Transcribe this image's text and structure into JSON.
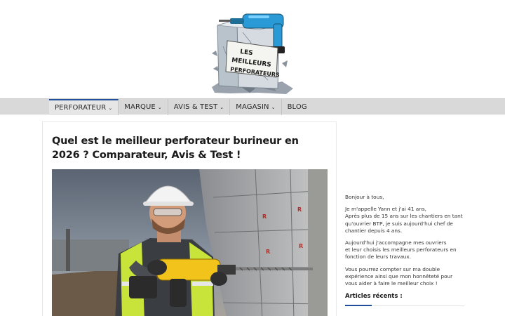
{
  "logo": {
    "line1": "LES",
    "line2": "MEILLEURS",
    "line3": "PERFORATEURS"
  },
  "nav": {
    "items": [
      {
        "label": "PERFORATEUR",
        "dropdown": true,
        "active": true
      },
      {
        "label": "MARQUE",
        "dropdown": true,
        "active": false
      },
      {
        "label": "AVIS & TEST",
        "dropdown": true,
        "active": false
      },
      {
        "label": "MAGASIN",
        "dropdown": true,
        "active": false
      },
      {
        "label": "BLOG",
        "dropdown": false,
        "active": false
      }
    ],
    "caret": "⌄"
  },
  "article": {
    "title": "Quel est le meilleur perforateur burineur en 2026 ? Comparateur, Avis & Test !"
  },
  "sidebar": {
    "greeting": "Bonjour à tous,",
    "p1": "Je m'appelle Yann et j'ai 41 ans,\nAprès plus de 15 ans sur les chantiers en tant qu'ouvrier BTP, je suis aujourd'hui chef de chantier depuis 4 ans.",
    "p2": "Aujourd'hui j'accompagne mes ouvriers\net leur choisis les meilleurs perforateurs en fonction de leurs travaux.",
    "p3": "Vous pourrez compter sur ma double expérience ainsi que mon honnêteté pour vous aider à faire le meilleur choix !",
    "recent_heading": "Articles récents :"
  },
  "colors": {
    "accent": "#1f4f9a",
    "nav_bg": "#d9d9d9",
    "drill_yellow": "#f2c31a",
    "logo_drill_blue": "#2a9ad6"
  }
}
